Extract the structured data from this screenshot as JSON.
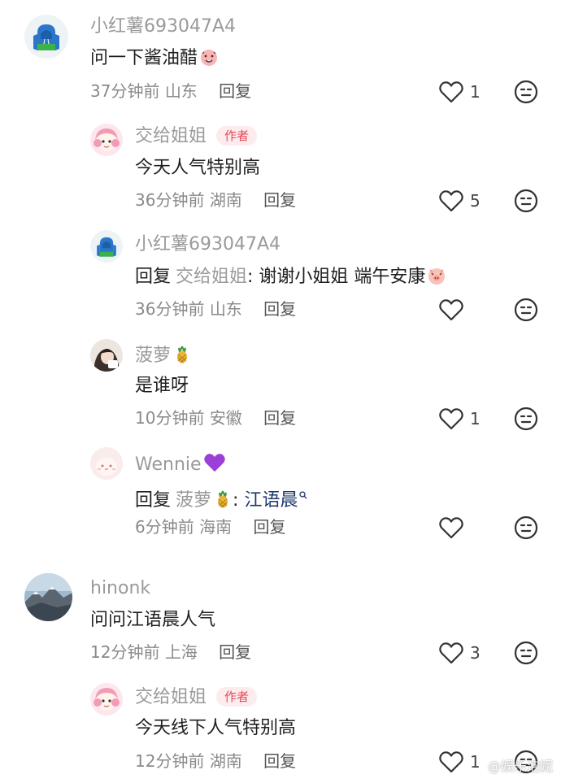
{
  "comments": [
    {
      "name": "小红薯693047A4",
      "text": "问一下酱油醋",
      "time": "37分钟前",
      "location": "山东",
      "reply_label": "回复",
      "likes": "1"
    },
    {
      "name": "交给姐姐",
      "badge": "作者",
      "text": "今天人气特别高",
      "time": "36分钟前",
      "location": "湖南",
      "reply_label": "回复",
      "likes": "5"
    },
    {
      "name": "小红薯693047A4",
      "reply_prefix": "回复",
      "reply_target": "交给姐姐",
      "text": ": 谢谢小姐姐 端午安康",
      "time": "36分钟前",
      "location": "山东",
      "reply_label": "回复",
      "likes": ""
    },
    {
      "name": "菠萝",
      "text": "是谁呀",
      "time": "10分钟前",
      "location": "安徽",
      "reply_label": "回复",
      "likes": "1"
    },
    {
      "name": "Wennie",
      "reply_prefix": "回复",
      "reply_target": "菠萝",
      "text_sep": ": ",
      "mention": "江语晨",
      "time": "6分钟前",
      "location": "海南",
      "reply_label": "回复",
      "likes": ""
    },
    {
      "name": "hinonk",
      "text": "问问江语晨人气",
      "time": "12分钟前",
      "location": "上海",
      "reply_label": "回复",
      "likes": "3"
    },
    {
      "name": "交给姐姐",
      "badge": "作者",
      "text": "今天线下人气特别高",
      "time": "12分钟前",
      "location": "湖南",
      "reply_label": "回复",
      "likes": "1"
    }
  ],
  "watermark": "@娱乐泡妮",
  "icons": {
    "like": "heart-outline-icon",
    "dislike": "neutral-face-icon",
    "avatar_1": "hoodie-avatar-icon",
    "avatar_2": "anime-girl-avatar-icon",
    "avatar_4": "girl-photo-avatar-icon",
    "avatar_5": "cute-character-avatar-icon",
    "avatar_6": "mountain-photo-avatar-icon"
  },
  "colors": {
    "name": "#9a9a9a",
    "author_badge_bg": "#fdecee",
    "author_badge_text": "#e8475a",
    "mention": "#1e3a6e"
  }
}
